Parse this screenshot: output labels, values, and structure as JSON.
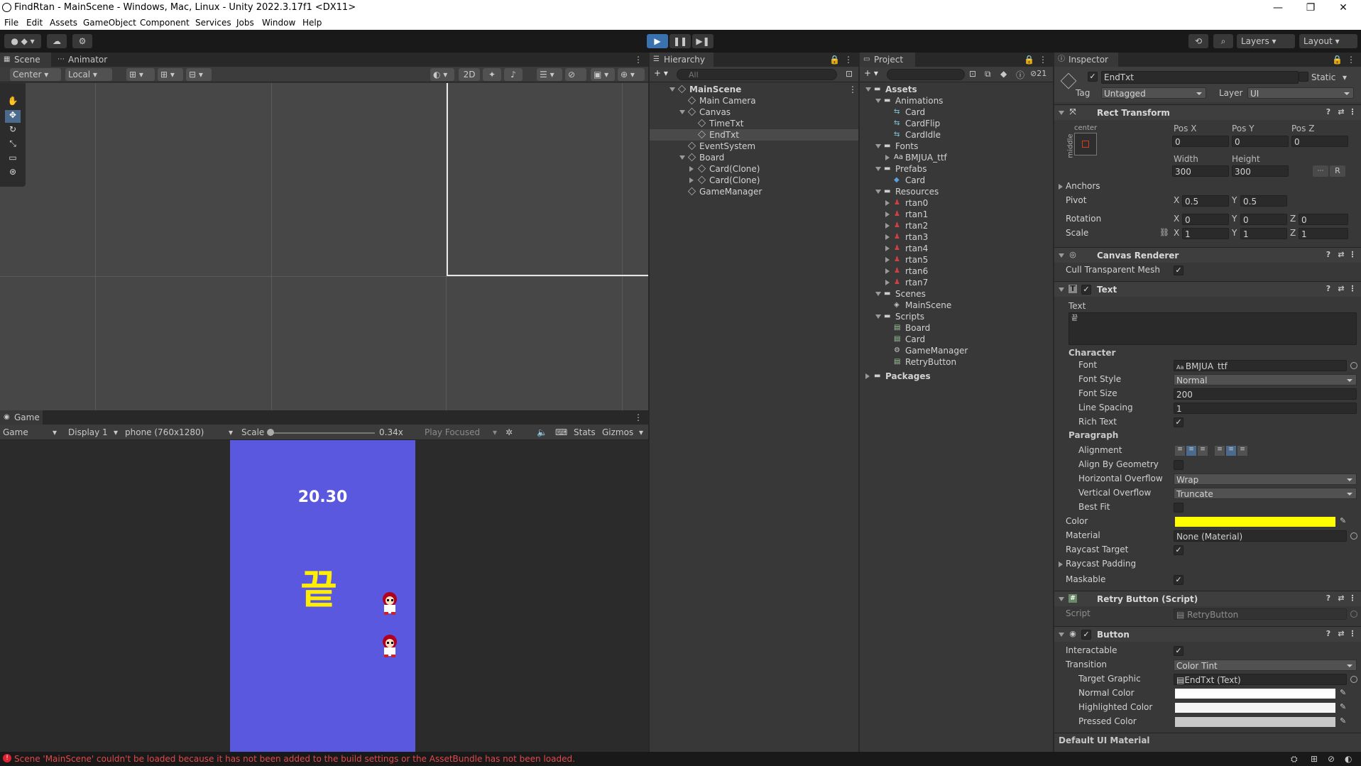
{
  "window": {
    "title": "FindRtan - MainScene - Windows, Mac, Linux - Unity 2022.3.17f1 <DX11>",
    "minimize": "—",
    "maximize": "❐",
    "close": "✕"
  },
  "menu": [
    "File",
    "Edit",
    "Assets",
    "GameObject",
    "Component",
    "Services",
    "Jobs",
    "Window",
    "Help"
  ],
  "toolbar": {
    "layers_label": "Layers",
    "layout_label": "Layout"
  },
  "scene": {
    "tabs": [
      "Scene",
      "Animator"
    ],
    "pivot_mode": "Center",
    "space_mode": "Local",
    "mode_2d": "2D"
  },
  "game": {
    "tab": "Game",
    "view_select": "Game",
    "display": "Display 1",
    "resolution": "phone (760x1280)",
    "scale_label": "Scale",
    "scale_value": "0.34x",
    "play_mode": "Play Focused",
    "stats": "Stats",
    "gizmos": "Gizmos",
    "timer_text": "20.30",
    "end_text": "끝",
    "background_color": "#5b58e0",
    "end_text_color": "#ffee00"
  },
  "hierarchy": {
    "tab": "Hierarchy",
    "search_placeholder": "All",
    "items": [
      {
        "label": "MainScene"
      },
      {
        "label": "Main Camera"
      },
      {
        "label": "Canvas"
      },
      {
        "label": "TimeTxt"
      },
      {
        "label": "EndTxt"
      },
      {
        "label": "EventSystem"
      },
      {
        "label": "Board"
      },
      {
        "label": "Card(Clone)"
      },
      {
        "label": "Card(Clone)"
      },
      {
        "label": "GameManager"
      }
    ]
  },
  "project": {
    "tab": "Project",
    "hidden_count": "21",
    "items": [
      {
        "label": "Assets"
      },
      {
        "label": "Animations"
      },
      {
        "label": "Card"
      },
      {
        "label": "CardFlip"
      },
      {
        "label": "CardIdle"
      },
      {
        "label": "Fonts"
      },
      {
        "label": "BMJUA_ttf"
      },
      {
        "label": "Prefabs"
      },
      {
        "label": "Card"
      },
      {
        "label": "Resources"
      },
      {
        "label": "rtan0"
      },
      {
        "label": "rtan1"
      },
      {
        "label": "rtan2"
      },
      {
        "label": "rtan3"
      },
      {
        "label": "rtan4"
      },
      {
        "label": "rtan5"
      },
      {
        "label": "rtan6"
      },
      {
        "label": "rtan7"
      },
      {
        "label": "Scenes"
      },
      {
        "label": "MainScene"
      },
      {
        "label": "Scripts"
      },
      {
        "label": "Board"
      },
      {
        "label": "Card"
      },
      {
        "label": "GameManager"
      },
      {
        "label": "RetryButton"
      },
      {
        "label": "Packages"
      }
    ]
  },
  "inspector": {
    "tab": "Inspector",
    "object_name": "EndTxt",
    "static_label": "Static",
    "tag_label": "Tag",
    "tag_value": "Untagged",
    "layer_label": "Layer",
    "layer_value": "UI",
    "rect_transform": {
      "title": "Rect Transform",
      "anchor_h": "center",
      "anchor_v": "middle",
      "posx_label": "Pos X",
      "posy_label": "Pos Y",
      "posz_label": "Pos Z",
      "posx": "0",
      "posy": "0",
      "posz": "0",
      "width_label": "Width",
      "height_label": "Height",
      "width": "300",
      "height": "300",
      "r_label": "R",
      "anchors_label": "Anchors",
      "pivot_label": "Pivot",
      "pivot_x": "0.5",
      "pivot_y": "0.5",
      "rotation_label": "Rotation",
      "rot_x": "0",
      "rot_y": "0",
      "rot_z": "0",
      "scale_label": "Scale",
      "scale_x": "1",
      "scale_y": "1",
      "scale_z": "1",
      "x": "X",
      "y": "Y",
      "z": "Z"
    },
    "canvas_renderer": {
      "title": "Canvas Renderer",
      "cull_label": "Cull Transparent Mesh"
    },
    "text": {
      "title": "Text",
      "text_label": "Text",
      "text_value": "끝",
      "character_label": "Character",
      "font_label": "Font",
      "font_value": "BMJUA_ttf",
      "font_style_label": "Font Style",
      "font_style_value": "Normal",
      "font_size_label": "Font Size",
      "font_size_value": "200",
      "line_spacing_label": "Line Spacing",
      "line_spacing_value": "1",
      "rich_text_label": "Rich Text",
      "paragraph_label": "Paragraph",
      "alignment_label": "Alignment",
      "align_geom_label": "Align By Geometry",
      "h_overflow_label": "Horizontal Overflow",
      "h_overflow_value": "Wrap",
      "v_overflow_label": "Vertical Overflow",
      "v_overflow_value": "Truncate",
      "best_fit_label": "Best Fit",
      "color_label": "Color",
      "color_value": "#ffff00",
      "material_label": "Material",
      "material_value": "None (Material)",
      "raycast_label": "Raycast Target",
      "raycast_padding_label": "Raycast Padding",
      "maskable_label": "Maskable"
    },
    "retry_script": {
      "title": "Retry Button (Script)",
      "script_label": "Script",
      "script_value": "RetryButton"
    },
    "button": {
      "title": "Button",
      "interactable_label": "Interactable",
      "transition_label": "Transition",
      "transition_value": "Color Tint",
      "target_graphic_label": "Target Graphic",
      "target_graphic_value": "EndTxt (Text)",
      "normal_color_label": "Normal Color",
      "normal_color": "#ffffff",
      "highlighted_color_label": "Highlighted Color",
      "highlighted_color": "#f5f5f5",
      "pressed_color_label": "Pressed Color",
      "pressed_color": "#c8c8c8"
    },
    "footer": "Default UI Material"
  },
  "status": {
    "message": "Scene 'MainScene' couldn't be loaded because it has not been added to the build settings or the AssetBundle has not been loaded."
  }
}
